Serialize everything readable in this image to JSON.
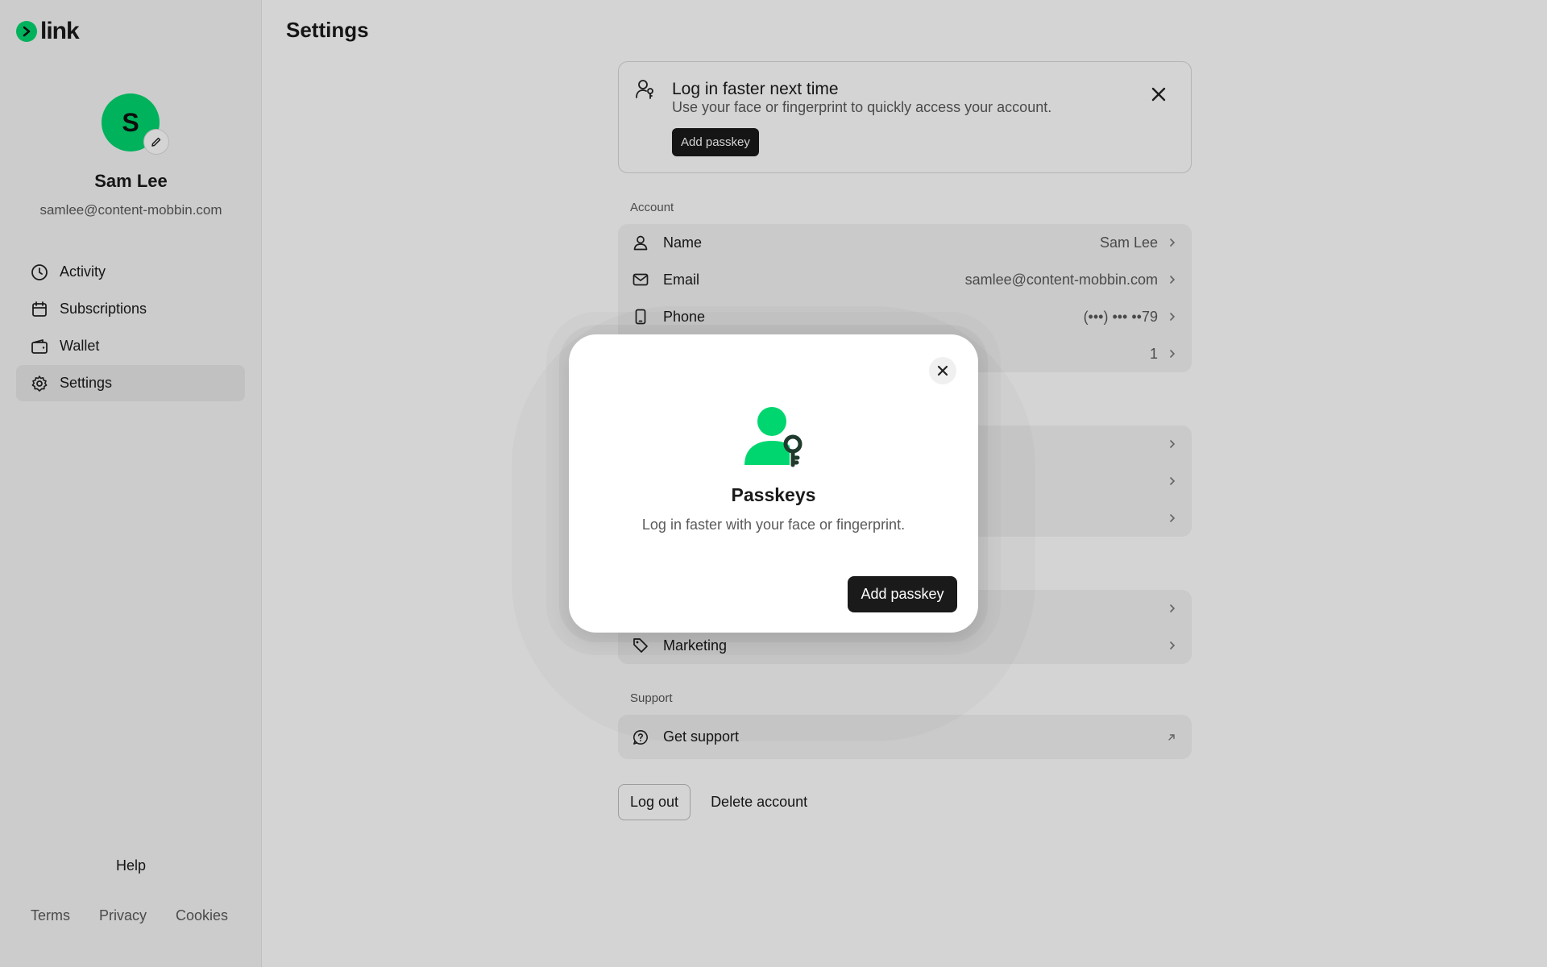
{
  "brand": {
    "name": "link",
    "accent": "#00d66f"
  },
  "profile": {
    "initial": "S",
    "name": "Sam Lee",
    "email": "samlee@content-mobbin.com"
  },
  "nav": [
    {
      "label": "Activity",
      "icon": "clock-icon"
    },
    {
      "label": "Subscriptions",
      "icon": "calendar-icon"
    },
    {
      "label": "Wallet",
      "icon": "wallet-icon"
    },
    {
      "label": "Settings",
      "icon": "gear-icon",
      "active": true
    }
  ],
  "help": "Help",
  "footer": {
    "terms": "Terms",
    "privacy": "Privacy",
    "cookies": "Cookies"
  },
  "page": {
    "title": "Settings"
  },
  "banner": {
    "title": "Log in faster next time",
    "subtitle": "Use your face or fingerprint to quickly access your account.",
    "button": "Add passkey"
  },
  "account": {
    "label": "Account",
    "rows": [
      {
        "label": "Name",
        "value": "Sam Lee",
        "icon": "person-icon"
      },
      {
        "label": "Email",
        "value": "samlee@content-mobbin.com",
        "icon": "mail-icon"
      },
      {
        "label": "Phone",
        "value": "(•••) ••• ••79",
        "icon": "phone-icon"
      },
      {
        "label": "",
        "value": "1",
        "icon": ""
      }
    ]
  },
  "marketing_row": {
    "label": "Marketing",
    "icon": "tag-icon"
  },
  "support": {
    "label": "Support",
    "row_label": "Get support"
  },
  "actions": {
    "logout": "Log out",
    "delete": "Delete account"
  },
  "modal": {
    "title": "Passkeys",
    "subtitle": "Log in faster with your face or fingerprint.",
    "button": "Add passkey"
  }
}
